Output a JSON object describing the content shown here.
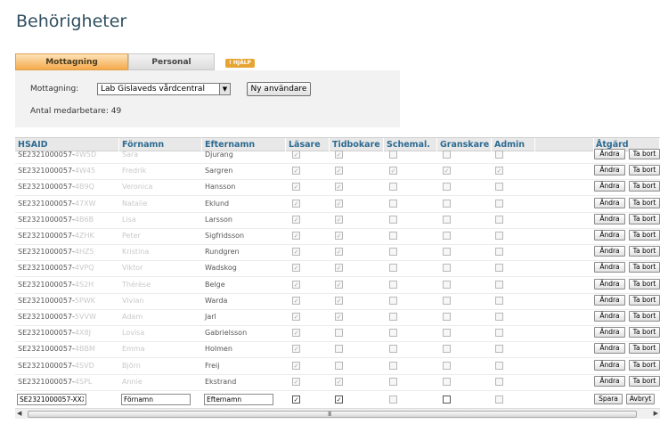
{
  "page": {
    "title": "Behörigheter"
  },
  "tabs": [
    {
      "label": "Mottagning",
      "active": true
    },
    {
      "label": "Personal",
      "active": false
    }
  ],
  "help_label": "! HJÄLP",
  "panel": {
    "mottagning_label": "Mottagning:",
    "selected_mottagning": "Lab Gislaveds vårdcentral",
    "new_user_button": "Ny användare",
    "staff_count_text": "Antal medarbetare: 49"
  },
  "table": {
    "columns": [
      "HSAID",
      "Förnamn",
      "Efternamn",
      "Läsare",
      "Tidbokare",
      "Schemal.",
      "Granskare",
      "Admin",
      "",
      "Åtgärd"
    ],
    "edit_label": "Ändra",
    "delete_label": "Ta bort",
    "rows": [
      {
        "hsaid": "SE2321000057-",
        "hsaid_blur": "4W5D",
        "first_blur": "Sara",
        "last": "Djurang",
        "lasare": true,
        "tidbokare": true,
        "schemal": false,
        "granskare": false,
        "admin": false
      },
      {
        "hsaid": "SE2321000057-",
        "hsaid_blur": "4W45",
        "first_blur": "Fredrik",
        "last": "Sargren",
        "lasare": true,
        "tidbokare": true,
        "schemal": true,
        "granskare": true,
        "admin": true
      },
      {
        "hsaid": "SE2321000057-",
        "hsaid_blur": "4B9Q",
        "first_blur": "Veronica",
        "last": "Hansson",
        "lasare": true,
        "tidbokare": true,
        "schemal": false,
        "granskare": false,
        "admin": false
      },
      {
        "hsaid": "SE2321000057-",
        "hsaid_blur": "47XW",
        "first_blur": "Natalie",
        "last": "Eklund",
        "lasare": true,
        "tidbokare": true,
        "schemal": false,
        "granskare": false,
        "admin": false
      },
      {
        "hsaid": "SE2321000057-",
        "hsaid_blur": "4B6B",
        "first_blur": "Lisa",
        "last": "Larsson",
        "lasare": true,
        "tidbokare": true,
        "schemal": false,
        "granskare": false,
        "admin": false
      },
      {
        "hsaid": "SE2321000057-",
        "hsaid_blur": "4ZHK",
        "first_blur": "Peter",
        "last": "Sigfridsson",
        "lasare": true,
        "tidbokare": true,
        "schemal": false,
        "granskare": false,
        "admin": false
      },
      {
        "hsaid": "SE2321000057-",
        "hsaid_blur": "4HZ5",
        "first_blur": "Kristina",
        "last": "Rundgren",
        "lasare": true,
        "tidbokare": true,
        "schemal": false,
        "granskare": false,
        "admin": false
      },
      {
        "hsaid": "SE2321000057-",
        "hsaid_blur": "4VPQ",
        "first_blur": "Viktor",
        "last": "Wadskog",
        "lasare": true,
        "tidbokare": true,
        "schemal": false,
        "granskare": false,
        "admin": false
      },
      {
        "hsaid": "SE2321000057-",
        "hsaid_blur": "4S2H",
        "first_blur": "Thérèse",
        "last": "Belge",
        "lasare": true,
        "tidbokare": true,
        "schemal": false,
        "granskare": false,
        "admin": false
      },
      {
        "hsaid": "SE2321000057-",
        "hsaid_blur": "5PWK",
        "first_blur": "Vivian",
        "last": "Warda",
        "lasare": true,
        "tidbokare": true,
        "schemal": false,
        "granskare": false,
        "admin": false
      },
      {
        "hsaid": "SE2321000057-",
        "hsaid_blur": "5VVW",
        "first_blur": "Adam",
        "last": "Jarl",
        "lasare": true,
        "tidbokare": true,
        "schemal": false,
        "granskare": false,
        "admin": false
      },
      {
        "hsaid": "SE2321000057-",
        "hsaid_blur": "4X8J",
        "first_blur": "Lovisa",
        "last": "Gabrielsson",
        "lasare": true,
        "tidbokare": false,
        "schemal": false,
        "granskare": false,
        "admin": false
      },
      {
        "hsaid": "SE2321000057-",
        "hsaid_blur": "4BBM",
        "first_blur": "Emma",
        "last": "Holmen",
        "lasare": true,
        "tidbokare": false,
        "schemal": false,
        "granskare": false,
        "admin": false
      },
      {
        "hsaid": "SE2321000057-",
        "hsaid_blur": "4SVD",
        "first_blur": "Björn",
        "last": "Freij",
        "lasare": true,
        "tidbokare": false,
        "schemal": false,
        "granskare": false,
        "admin": false
      },
      {
        "hsaid": "SE2321000057-",
        "hsaid_blur": "4SPL",
        "first_blur": "Annie",
        "last": "Ekstrand",
        "lasare": true,
        "tidbokare": true,
        "schemal": false,
        "granskare": false,
        "admin": false
      }
    ],
    "new_row": {
      "hsaid_value": "SE2321000057-XXXX",
      "first_value": "Förnamn",
      "last_value": "Efternamn",
      "lasare": true,
      "tidbokare": true,
      "schemal": false,
      "granskare": false,
      "admin": false,
      "save_label": "Spara",
      "cancel_label": "Avbryt"
    }
  },
  "scrollbar": {
    "left_arrow": "◀",
    "right_arrow": "▶",
    "grip": "III"
  }
}
